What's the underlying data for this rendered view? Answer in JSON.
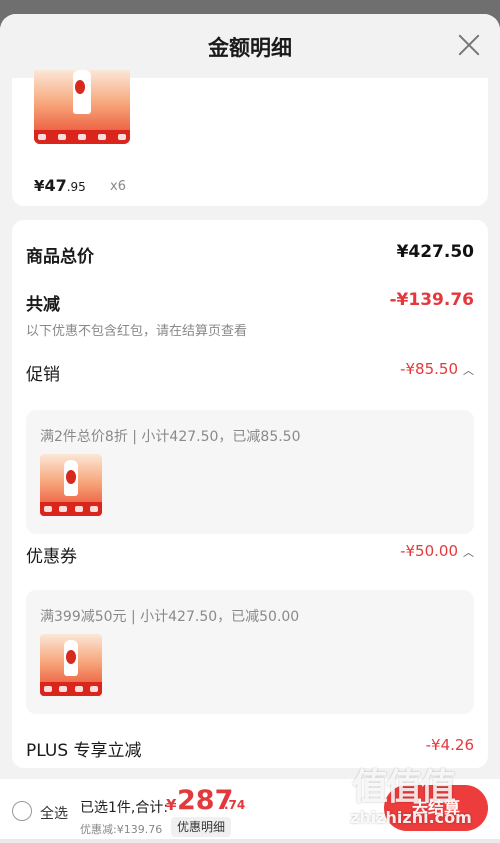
{
  "header": {
    "title": "金额明细"
  },
  "product": {
    "yen": "¥",
    "price_int": "47",
    "price_dec": ".95",
    "qty": "x6"
  },
  "summary": {
    "total_label": "商品总价",
    "total_value": "¥427.50",
    "reduce_label": "共减",
    "reduce_value": "-¥139.76",
    "reduce_note": "以下优惠不包含红包，请在结算页查看"
  },
  "promotion": {
    "label": "促销",
    "value": "-¥85.50",
    "detail": "满2件总价8折 | 小计427.50，已减85.50"
  },
  "coupon": {
    "label": "优惠券",
    "value": "-¥50.00",
    "detail": "满399减50元 | 小计427.50，已减50.00"
  },
  "plus": {
    "label": "PLUS 专享立减",
    "value": "-¥4.26"
  },
  "bottom": {
    "select_all": "全选",
    "selected_text": "已选1件,合计:",
    "total_yen": "¥",
    "total_int": "287",
    "total_dec": ".74",
    "discount_text": "优惠减:¥139.76",
    "detail_button": "优惠明细",
    "checkout_button": "去结算"
  },
  "watermark": {
    "logo": "值值值",
    "site": "zhizhizhi.com"
  },
  "colors": {
    "accent_red": "#e4393c",
    "checkout_red": "#ec3c3c"
  }
}
